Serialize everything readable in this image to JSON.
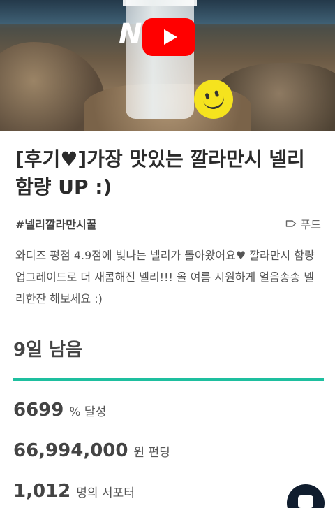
{
  "video": {
    "overlay_text": "N  :)",
    "play_icon": "youtube-play-icon",
    "colors": {
      "play_button": "#ff0000"
    }
  },
  "project": {
    "title": "[후기♥]가장 맛있는 깔라만시 넬리 함량 UP :)",
    "hashtag": "#넬리깔라만시꿀",
    "category": {
      "icon": "tag-icon",
      "label": "푸드"
    },
    "description": "와디즈 평점 4.9점에 빛나는 넬리가 돌아왔어요♥ 깔라만시 함량 업그레이드로 더 새콤해진 넬리!!! 올 여름 시원하게 얼음송송 넬리한잔 해보세요 :)"
  },
  "funding": {
    "remaining": "9일 남음",
    "progress_fraction": 1.0,
    "accent_color": "#1ebf9f",
    "stats": [
      {
        "value": "6699",
        "unit": "% 달성"
      },
      {
        "value": "66,994,000",
        "unit": "원 펀딩"
      },
      {
        "value": "1,012",
        "unit": "명의 서포터"
      }
    ]
  },
  "chat": {
    "icon": "chat-icon"
  }
}
